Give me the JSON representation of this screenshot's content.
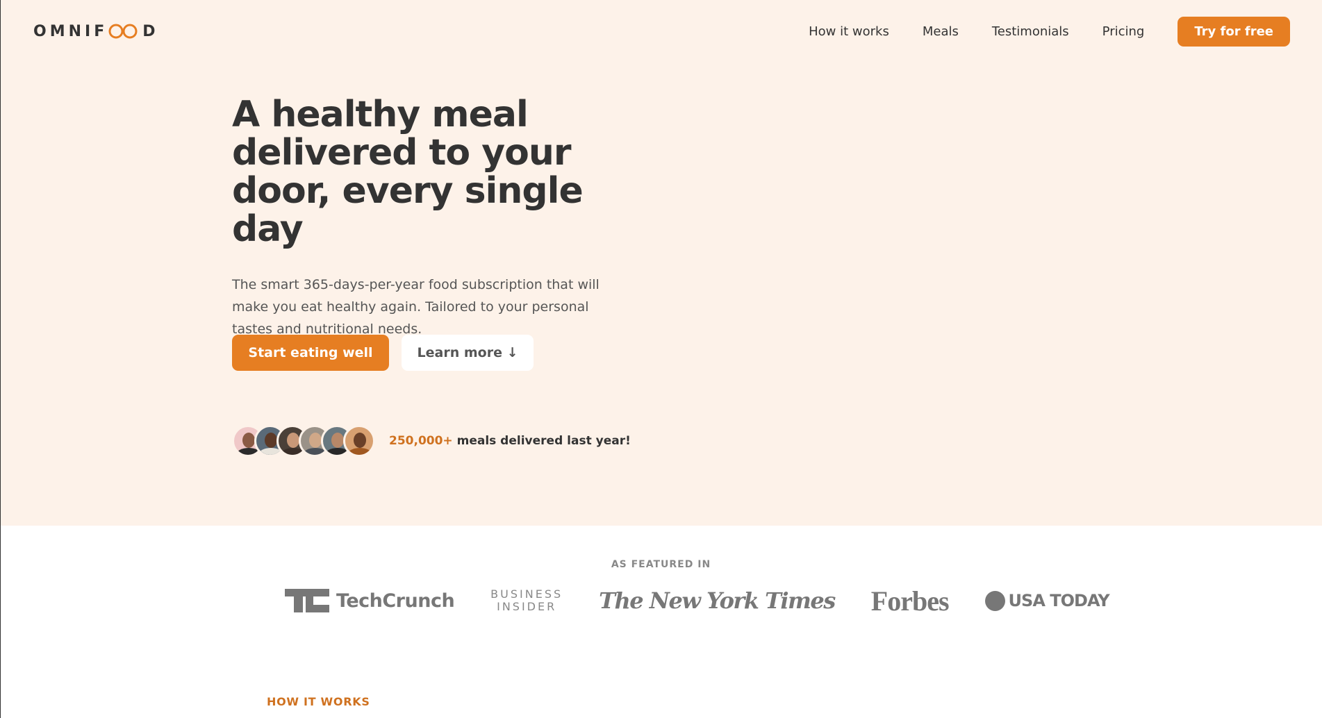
{
  "header": {
    "logo_prefix": "OMNIF",
    "logo_suffix": "D",
    "nav": [
      {
        "label": "How it works"
      },
      {
        "label": "Meals"
      },
      {
        "label": "Testimonials"
      },
      {
        "label": "Pricing"
      }
    ],
    "cta_label": "Try for free"
  },
  "hero": {
    "title": "A healthy meal delivered to your door, every single day",
    "description": "The smart 365-days-per-year food subscription that will make you eat healthy again. Tailored to your personal tastes and nutritional needs.",
    "primary_button": "Start eating well",
    "secondary_button": "Learn more ↓",
    "delivered_count": "250,000+",
    "delivered_text": " meals delivered last year!"
  },
  "featured": {
    "heading": "AS FEATURED IN",
    "logos": {
      "techcrunch": "TechCrunch",
      "business_insider_line1": "BUSINESS",
      "business_insider_line2": "INSIDER",
      "nyt": "The New York Times",
      "forbes": "Forbes",
      "usa_today": "USA TODAY"
    }
  },
  "how_it_works": {
    "label": "HOW IT WORKS"
  },
  "colors": {
    "accent": "#e67e22",
    "accent_dark": "#cf711f",
    "hero_bg": "#fdf2e9",
    "text": "#333333"
  }
}
